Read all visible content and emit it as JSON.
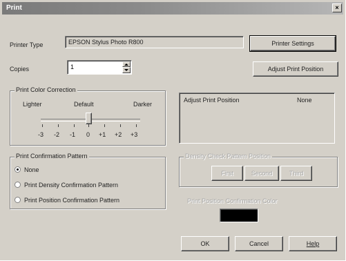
{
  "window": {
    "title": "Print",
    "close_glyph": "×"
  },
  "printer": {
    "label": "Printer Type",
    "value": "EPSON Stylus Photo R800",
    "settings_button": "Printer Settings"
  },
  "copies": {
    "label": "Copies",
    "value": "1"
  },
  "adjust_button": "Adjust Print Position",
  "color_correction": {
    "title": "Print Color Correction",
    "lighter": "Lighter",
    "default": "Default",
    "darker": "Darker",
    "scale": [
      "-3",
      "-2",
      "-1",
      "0",
      "+1",
      "+2",
      "+3"
    ],
    "selected": "0"
  },
  "adjust_list": {
    "col1": "Adjust Print Position",
    "col2": "None"
  },
  "confirmation": {
    "title": "Print Confirmation Pattern",
    "options": [
      "None",
      "Print Density Confirmation Pattern",
      "Print Position Confirmation Pattern"
    ],
    "selected_index": 0
  },
  "density_position": {
    "title": "Density Check Pattern Position",
    "buttons": [
      "First",
      "Second",
      "Third"
    ]
  },
  "position_color": {
    "label": "Print Position Confirmation Color",
    "swatch": "#000000"
  },
  "footer": {
    "ok": "OK",
    "cancel": "Cancel",
    "help": "Help"
  }
}
